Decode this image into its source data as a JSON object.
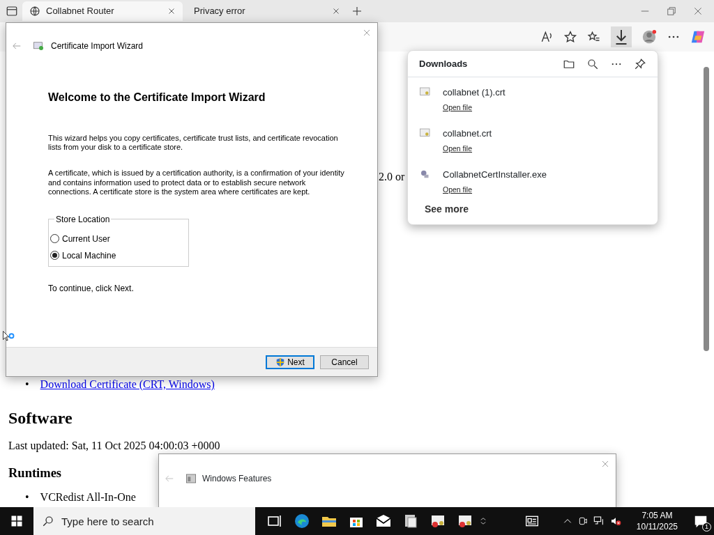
{
  "browser": {
    "tabs": [
      {
        "title": "Collabnet Router",
        "selected": true
      },
      {
        "title": "Privacy error",
        "selected": false
      }
    ],
    "page": {
      "fragment": "2.0 or",
      "marker": "•",
      "link": "Download Certificate (CRT, Windows)",
      "heading": "Software",
      "updated": "Last updated: Sat, 11 Oct 2025 04:00:03 +0000",
      "subheading": "Runtimes",
      "items": [
        "VCRedist All-In-One"
      ]
    }
  },
  "downloads": {
    "title": "Downloads",
    "items": [
      {
        "name": "collabnet (1).crt",
        "kind": "certificate",
        "action": "Open file"
      },
      {
        "name": "collabnet.crt",
        "kind": "certificate",
        "action": "Open file"
      },
      {
        "name": "CollabnetCertInstaller.exe",
        "kind": "installer",
        "action": "Open file"
      }
    ],
    "see_more": "See more"
  },
  "wizard": {
    "title": "Certificate Import Wizard",
    "heading": "Welcome to the Certificate Import Wizard",
    "paragraphs": [
      "This wizard helps you copy certificates, certificate trust lists, and certificate revocation lists from your disk to a certificate store.",
      "A certificate, which is issued by a certification authority, is a confirmation of your identity and contains information used to protect data or to establish secure network connections. A certificate store is the system area where certificates are kept."
    ],
    "store": {
      "legend": "Store Location",
      "options": [
        {
          "label": "Current User",
          "selected": false
        },
        {
          "label": "Local Machine",
          "selected": true
        }
      ]
    },
    "hint": "To continue, click Next.",
    "buttons": [
      {
        "label": "Next",
        "kind": "primary"
      },
      {
        "label": "Cancel",
        "kind": "secondary"
      }
    ]
  },
  "features_window": {
    "title": "Windows Features"
  },
  "taskbar": {
    "search": {
      "placeholder": "Type here to search"
    },
    "time": "7:05 AM",
    "date": "10/11/2025",
    "notifications": "1"
  }
}
